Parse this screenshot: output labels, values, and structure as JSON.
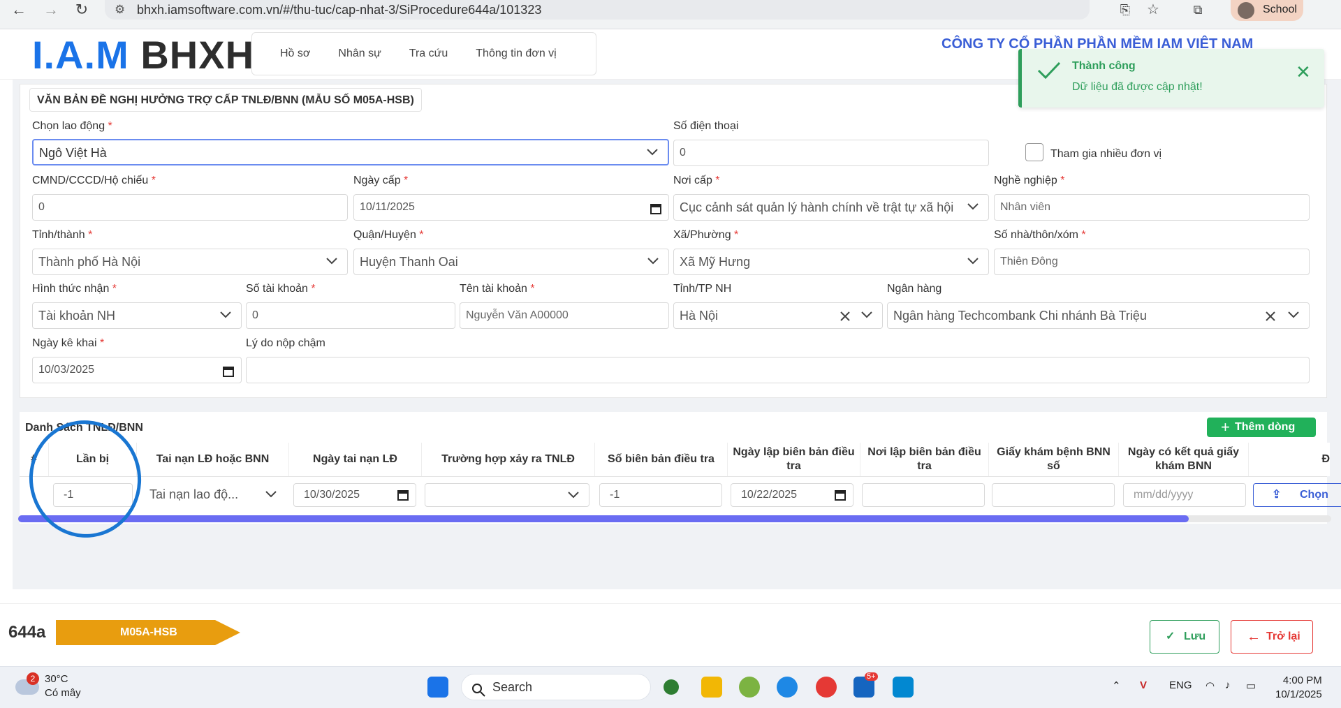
{
  "browser": {
    "url": "bhxh.iamsoftware.com.vn/#/thu-tuc/cap-nhat-3/SiProcedure644a/101323",
    "profile": "School"
  },
  "header": {
    "logo_a": "I.A.M",
    "logo_b": "BHXH",
    "menu": [
      "Hồ sơ",
      "Nhân sự",
      "Tra cứu",
      "Thông tin đơn vị"
    ],
    "company": "CÔNG TY CỔ PHẦN PHẦN MỀM IAM VIỆT NAM"
  },
  "toast": {
    "title": "Thành công",
    "message": "Dữ liệu đã được cập nhật!"
  },
  "form": {
    "legend": "VĂN BẢN ĐỀ NGHỊ HƯỞNG TRỢ CẤP TNLĐ/BNN (MẪU SỐ M05A-HSB)",
    "fields": {
      "chon_lao_dong": {
        "label": "Chọn lao động",
        "value": "Ngô Việt Hà"
      },
      "so_dien_thoai": {
        "label": "Số điện thoại",
        "value": "0"
      },
      "tham_gia": {
        "label": "Tham gia nhiều đơn vị"
      },
      "cmnd": {
        "label": "CMND/CCCD/Hộ chiếu",
        "value": "0"
      },
      "ngay_cap": {
        "label": "Ngày cấp",
        "value": "10/11/2025"
      },
      "noi_cap": {
        "label": "Nơi cấp",
        "value": "Cục cảnh sát quản lý hành chính về trật tự xã hội"
      },
      "nghe_nghiep": {
        "label": "Nghề nghiệp",
        "value": "Nhân viên"
      },
      "tinh_thanh": {
        "label": "Tỉnh/thành",
        "value": "Thành phố Hà Nội"
      },
      "quan_huyen": {
        "label": "Quận/Huyện",
        "value": "Huyện Thanh Oai"
      },
      "xa_phuong": {
        "label": "Xã/Phường",
        "value": "Xã Mỹ Hưng"
      },
      "so_nha": {
        "label": "Số nhà/thôn/xóm",
        "value": "Thiên Đông"
      },
      "hinh_thuc_nhan": {
        "label": "Hình thức nhận",
        "value": "Tài khoản NH"
      },
      "so_tai_khoan": {
        "label": "Số tài khoản",
        "value": "0"
      },
      "ten_tai_khoan": {
        "label": "Tên tài khoản",
        "value": "Nguyễn Văn A00000"
      },
      "tinh_tp_nh": {
        "label": "Tỉnh/TP NH",
        "value": "Hà Nội"
      },
      "ngan_hang": {
        "label": "Ngân hàng",
        "value": "Ngân hàng Techcombank Chi nhánh Bà Triệu"
      },
      "ngay_ke_khai": {
        "label": "Ngày kê khai",
        "value": "10/03/2025"
      },
      "ly_do": {
        "label": "Lý do nộp chậm",
        "value": ""
      }
    },
    "required_mark": "*"
  },
  "table": {
    "title": "Danh Sách TNLĐ/BNN",
    "add_label": "Thêm dòng",
    "columns": [
      "#",
      "Lần bị",
      "Tai nạn LĐ hoặc BNN",
      "Ngày tai nạn LĐ",
      "Trường hợp xảy ra TNLĐ",
      "Số biên bản điều tra",
      "Ngày lập biên bản điều tra",
      "Nơi lập biên bản điều tra",
      "Giấy khám bệnh BNN số",
      "Ngày có kết quả giấy khám BNN",
      "Đ"
    ],
    "row": {
      "lan_bi": "-1",
      "tai_nan": "Tai nạn lao độ...",
      "ngay_tai_nan": "10/30/2025",
      "truong_hop": "",
      "so_bien_ban": "-1",
      "ngay_lap": "10/22/2025",
      "noi_lap": "",
      "giay_kham": "",
      "ngay_kq_placeholder": "mm/dd/yyyy",
      "choose_label": "Chọn"
    }
  },
  "footer": {
    "proc_code": "644a",
    "form_code": "M05A-HSB",
    "save_label": "Lưu",
    "back_label": "Trở lại",
    "badge_color": "#e89d0f"
  },
  "taskbar": {
    "temp": "30°C",
    "weather": "Có mây",
    "weather_badge": "2",
    "search": "Search",
    "lang": "ENG",
    "time": "4:00 PM",
    "date": "10/1/2025",
    "zalo_badge": "5+"
  }
}
